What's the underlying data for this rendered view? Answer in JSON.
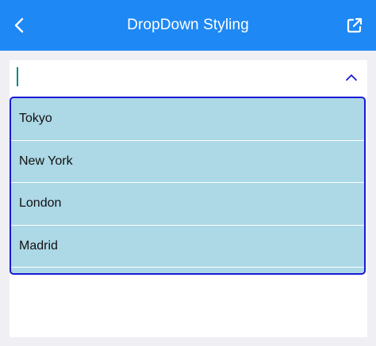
{
  "appbar": {
    "title": "DropDown Styling",
    "back_icon": "chevron-left-icon",
    "open_icon": "open-external-icon",
    "color": "#1e88f5"
  },
  "combo": {
    "value": "",
    "expanded": true,
    "toggle_icon": "chevron-up-icon",
    "caret_color": "#00897b"
  },
  "dropdown": {
    "background": "#add8e6",
    "border_color": "#1a1ad6",
    "items": [
      {
        "label": "Tokyo"
      },
      {
        "label": "New York"
      },
      {
        "label": "London"
      },
      {
        "label": "Madrid"
      }
    ]
  }
}
